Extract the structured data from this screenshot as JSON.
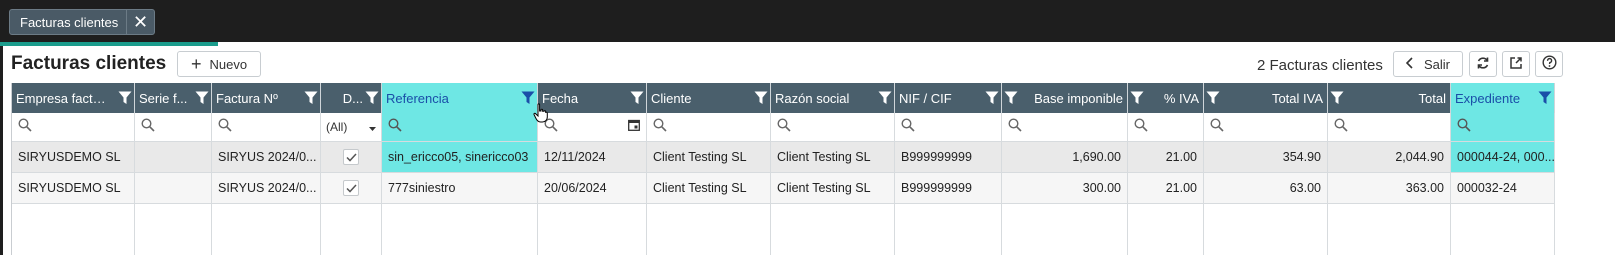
{
  "window_tab": {
    "label": "Facturas clientes",
    "close_glyph": "✕"
  },
  "page": {
    "title": "Facturas clientes",
    "new_button": "Nuevo",
    "record_count": "2 Facturas clientes",
    "exit_button": "Salir"
  },
  "icons": {
    "refresh": "refresh-icon",
    "export": "export-icon",
    "help": "help-icon"
  },
  "colors": {
    "header": "#4a5f6c",
    "selected_column": "#6ee7e4",
    "progress": "#1a9c8c"
  },
  "filter": {
    "d_select": "(All)"
  },
  "columns": [
    "Empresa factur...",
    "Serie f...",
    "Factura Nº",
    "D...",
    "Referencia",
    "Fecha",
    "Cliente",
    "Razón social",
    "NIF / CIF",
    "Base imponible",
    "% IVA",
    "Total IVA",
    "Total",
    "Expediente"
  ],
  "rows": [
    {
      "empresa": "SIRYUSDEMO SL",
      "serie": "",
      "factura": "SIRYUS 2024/0...",
      "d": true,
      "referencia": "sin_ericco05, sinericco03",
      "fecha": "12/11/2024",
      "cliente": "Client Testing SL",
      "razon": "Client Testing SL",
      "nif": "B999999999",
      "base": "1,690.00",
      "iva_pct": "21.00",
      "total_iva": "354.90",
      "total": "2,044.90",
      "expediente": "000044-24, 000..."
    },
    {
      "empresa": "SIRYUSDEMO SL",
      "serie": "",
      "factura": "SIRYUS 2024/0...",
      "d": true,
      "referencia": "777siniestro",
      "fecha": "20/06/2024",
      "cliente": "Client Testing SL",
      "razon": "Client Testing SL",
      "nif": "B999999999",
      "base": "300.00",
      "iva_pct": "21.00",
      "total_iva": "63.00",
      "total": "363.00",
      "expediente": "000032-24"
    }
  ]
}
